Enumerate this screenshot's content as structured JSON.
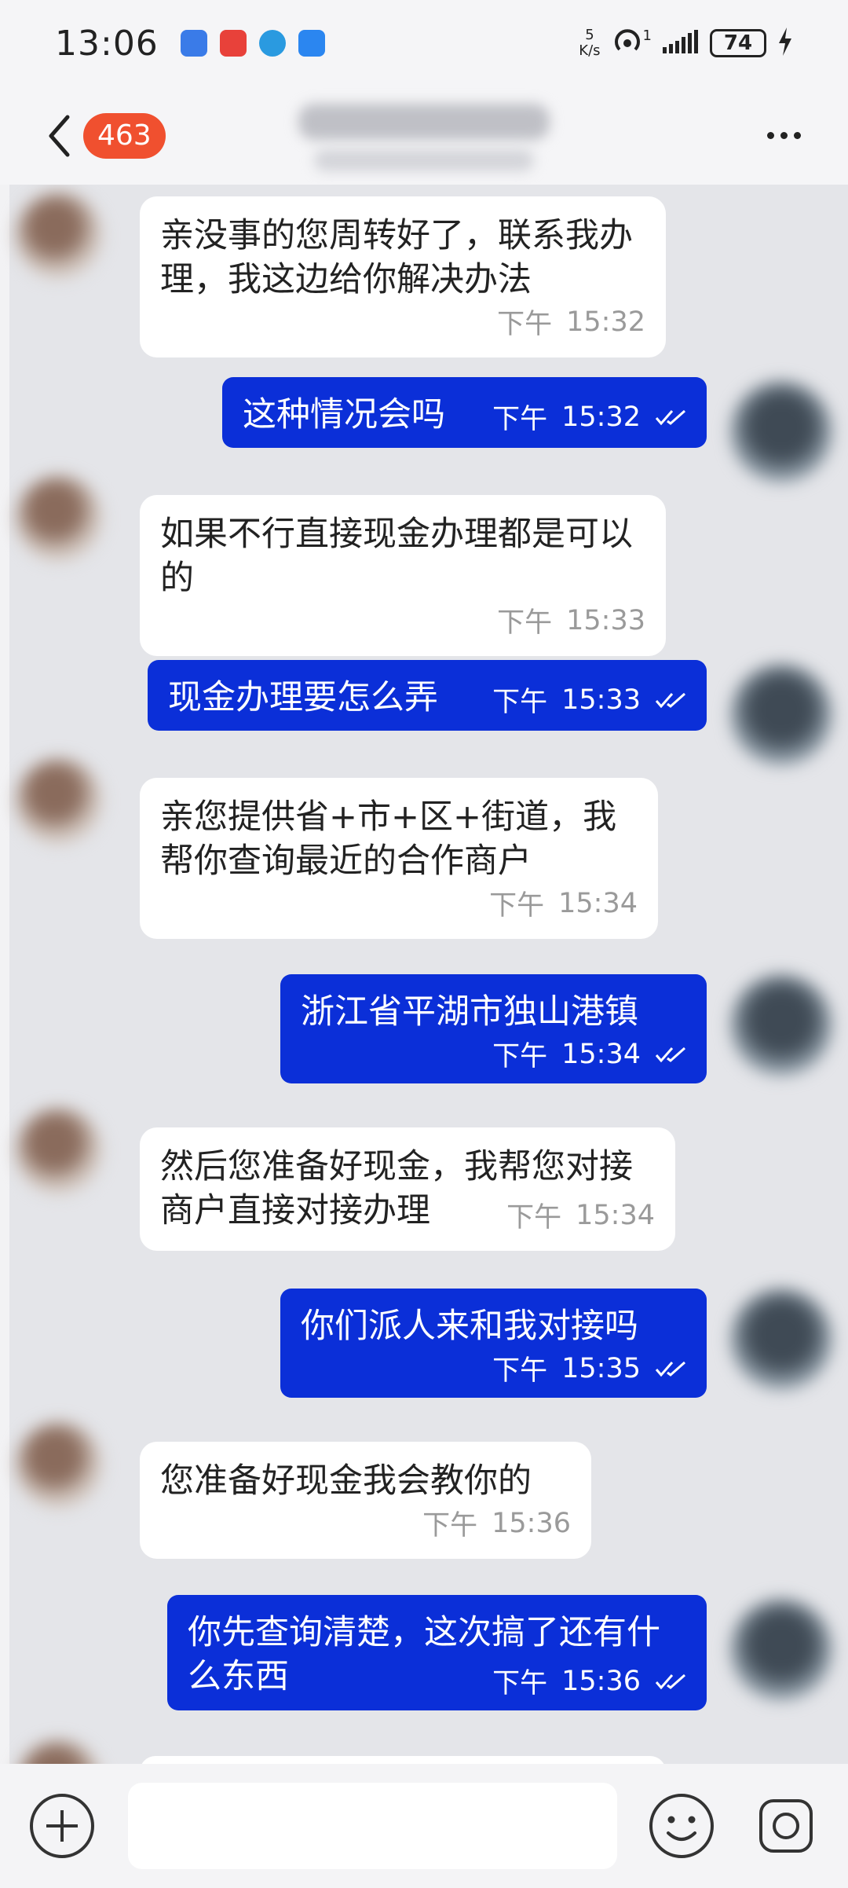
{
  "status_bar": {
    "time": "13:06",
    "net_speed_value": "5",
    "net_speed_unit": "K/s",
    "signal_badge": "1",
    "battery": "74",
    "app_icons": [
      "usb-icon",
      "huawei-app-icon",
      "telegram-icon",
      "weather-icon"
    ]
  },
  "header": {
    "unread_count": "463"
  },
  "messages": [
    {
      "side": "in",
      "text": "亲没事的您周转好了，联系我办理，我这边给你解决办法",
      "period": "下午",
      "time": "15:32"
    },
    {
      "side": "out",
      "text": "这种情况会吗",
      "period": "下午",
      "time": "15:32"
    },
    {
      "side": "in",
      "text": "如果不行直接现金办理都是可以的",
      "period": "下午",
      "time": "15:33"
    },
    {
      "side": "out",
      "text": "现金办理要怎么弄",
      "period": "下午",
      "time": "15:33"
    },
    {
      "side": "in",
      "text": "亲您提供省+市+区+街道，我帮你查询最近的合作商户",
      "period": "下午",
      "time": "15:34"
    },
    {
      "side": "out",
      "text": "浙江省平湖市独山港镇",
      "period": "下午",
      "time": "15:34"
    },
    {
      "side": "in",
      "text": "然后您准备好现金，我帮您对接商户直接对接办理",
      "period": "下午",
      "time": "15:34"
    },
    {
      "side": "out",
      "text": "你们派人来和我对接吗",
      "period": "下午",
      "time": "15:35"
    },
    {
      "side": "in",
      "text": "您准备好现金我会教你的",
      "period": "下午",
      "time": "15:36"
    },
    {
      "side": "out",
      "text": "你先查询清楚，这次搞了还有什么东西",
      "period": "下午",
      "time": "15:36"
    }
  ],
  "colors": {
    "outgoing_bubble": "#0b2fd8",
    "incoming_bubble": "#ffffff",
    "badge": "#f0502f"
  }
}
